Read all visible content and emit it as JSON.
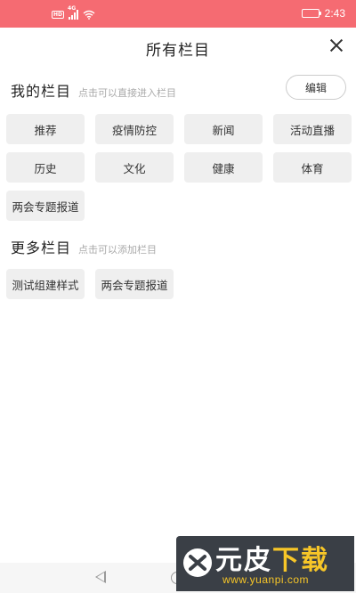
{
  "status_bar": {
    "hd": "HD",
    "network": "4G",
    "time": "2:43",
    "battery_level": 0.55,
    "color": "#f56b72"
  },
  "header": {
    "title": "所有栏目",
    "close_icon": "close-icon"
  },
  "my_channels": {
    "title": "我的栏目",
    "hint": "点击可以直接进入栏目",
    "edit_label": "编辑",
    "items": [
      "推荐",
      "疫情防控",
      "新闻",
      "活动直播",
      "历史",
      "文化",
      "健康",
      "体育",
      "两会专题报道"
    ]
  },
  "more_channels": {
    "title": "更多栏目",
    "hint": "点击可以添加栏目",
    "items": [
      "测试组建样式",
      "两会专题报道"
    ]
  },
  "nav": {
    "back_icon": "triangle-back-icon",
    "home_icon": "circle-home-icon"
  },
  "watermark": {
    "title_1": "元皮",
    "title_2": "下载",
    "url": "www.yuanpi.com"
  }
}
